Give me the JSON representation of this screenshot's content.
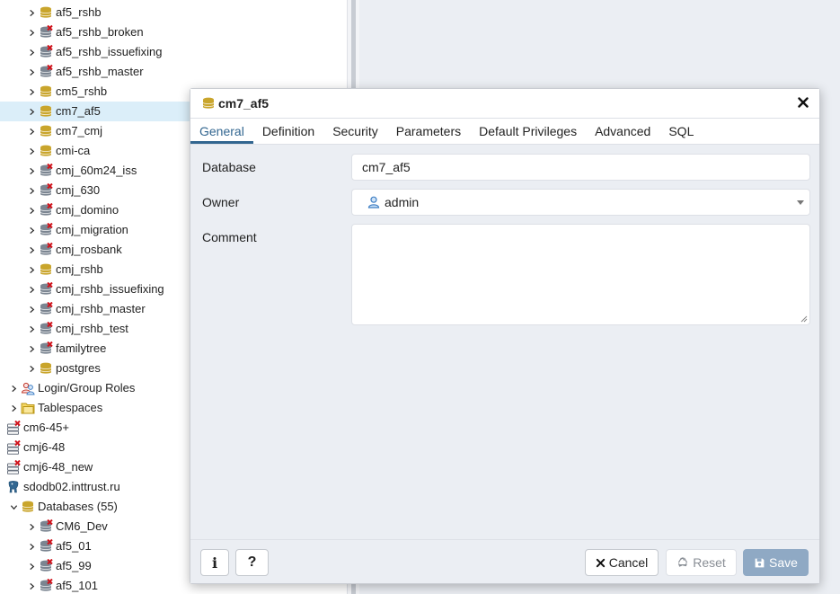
{
  "tree": {
    "nodes": [
      {
        "label": "af5_rshb",
        "icon": "database-icon",
        "state": "connected",
        "indent": 1,
        "expanded": false
      },
      {
        "label": "af5_rshb_broken",
        "icon": "database-icon",
        "state": "disconnected",
        "indent": 1,
        "expanded": false
      },
      {
        "label": "af5_rshb_issuefixing",
        "icon": "database-icon",
        "state": "disconnected",
        "indent": 1,
        "expanded": false
      },
      {
        "label": "af5_rshb_master",
        "icon": "database-icon",
        "state": "disconnected",
        "indent": 1,
        "expanded": false
      },
      {
        "label": "cm5_rshb",
        "icon": "database-icon",
        "state": "connected",
        "indent": 1,
        "expanded": false
      },
      {
        "label": "cm7_af5",
        "icon": "database-icon",
        "state": "connected",
        "indent": 1,
        "expanded": false,
        "selected": true
      },
      {
        "label": "cm7_cmj",
        "icon": "database-icon",
        "state": "connected",
        "indent": 1,
        "expanded": false
      },
      {
        "label": "cmi-ca",
        "icon": "database-icon",
        "state": "connected",
        "indent": 1,
        "expanded": false
      },
      {
        "label": "cmj_60m24_iss",
        "icon": "database-icon",
        "state": "disconnected",
        "indent": 1,
        "expanded": false
      },
      {
        "label": "cmj_630",
        "icon": "database-icon",
        "state": "disconnected",
        "indent": 1,
        "expanded": false
      },
      {
        "label": "cmj_domino",
        "icon": "database-icon",
        "state": "disconnected",
        "indent": 1,
        "expanded": false
      },
      {
        "label": "cmj_migration",
        "icon": "database-icon",
        "state": "disconnected",
        "indent": 1,
        "expanded": false
      },
      {
        "label": "cmj_rosbank",
        "icon": "database-icon",
        "state": "disconnected",
        "indent": 1,
        "expanded": false
      },
      {
        "label": "cmj_rshb",
        "icon": "database-icon",
        "state": "connected",
        "indent": 1,
        "expanded": false
      },
      {
        "label": "cmj_rshb_issuefixing",
        "icon": "database-icon",
        "state": "disconnected",
        "indent": 1,
        "expanded": false
      },
      {
        "label": "cmj_rshb_master",
        "icon": "database-icon",
        "state": "disconnected",
        "indent": 1,
        "expanded": false
      },
      {
        "label": "cmj_rshb_test",
        "icon": "database-icon",
        "state": "disconnected",
        "indent": 1,
        "expanded": false
      },
      {
        "label": "familytree",
        "icon": "database-icon",
        "state": "disconnected",
        "indent": 1,
        "expanded": false
      },
      {
        "label": "postgres",
        "icon": "database-icon",
        "state": "connected",
        "indent": 1,
        "expanded": false
      },
      {
        "label": "Login/Group Roles",
        "icon": "roles-icon",
        "state": "",
        "indent": 0,
        "expanded": false
      },
      {
        "label": "Tablespaces",
        "icon": "tablespaces-icon",
        "state": "",
        "indent": 0,
        "expanded": false
      },
      {
        "label": "cm6-45+",
        "icon": "server-icon",
        "state": "disconnected",
        "indent": -1,
        "expanded": null
      },
      {
        "label": "cmj6-48",
        "icon": "server-icon",
        "state": "disconnected",
        "indent": -1,
        "expanded": null
      },
      {
        "label": "cmj6-48_new",
        "icon": "server-icon",
        "state": "disconnected",
        "indent": -1,
        "expanded": null
      },
      {
        "label": "sdodb02.inttrust.ru",
        "icon": "postgres-elephant-icon",
        "state": "",
        "indent": -1,
        "expanded": null
      },
      {
        "label": "Databases (55)",
        "icon": "databases-icon",
        "state": "",
        "indent": 0,
        "expanded": true
      },
      {
        "label": "CM6_Dev",
        "icon": "database-icon",
        "state": "disconnected",
        "indent": 1,
        "expanded": false
      },
      {
        "label": "af5_01",
        "icon": "database-icon",
        "state": "disconnected",
        "indent": 1,
        "expanded": false
      },
      {
        "label": "af5_99",
        "icon": "database-icon",
        "state": "disconnected",
        "indent": 1,
        "expanded": false
      },
      {
        "label": "af5_101",
        "icon": "database-icon",
        "state": "disconnected",
        "indent": 1,
        "expanded": false
      }
    ]
  },
  "dialog": {
    "title": "cm7_af5",
    "title_icon": "database-icon",
    "close_icon": "close-icon",
    "tabs": [
      {
        "label": "General",
        "active": true
      },
      {
        "label": "Definition",
        "active": false
      },
      {
        "label": "Security",
        "active": false
      },
      {
        "label": "Parameters",
        "active": false
      },
      {
        "label": "Default Privileges",
        "active": false
      },
      {
        "label": "Advanced",
        "active": false
      },
      {
        "label": "SQL",
        "active": false
      }
    ],
    "fields": {
      "database": {
        "label": "Database",
        "value": "cm7_af5"
      },
      "owner": {
        "label": "Owner",
        "value": "admin",
        "icon": "user-icon"
      },
      "comment": {
        "label": "Comment",
        "value": ""
      }
    },
    "footer": {
      "info_label": "i",
      "help_label": "?",
      "cancel_label": "Cancel",
      "reset_label": "Reset",
      "save_label": "Save"
    }
  },
  "colors": {
    "accent": "#326690",
    "selected_row": "#dbeef9",
    "db_connected": "#c9a52c",
    "db_disconnected": "#7b8591",
    "error_x": "#d0121b",
    "save_button": "#8fa9c4"
  }
}
